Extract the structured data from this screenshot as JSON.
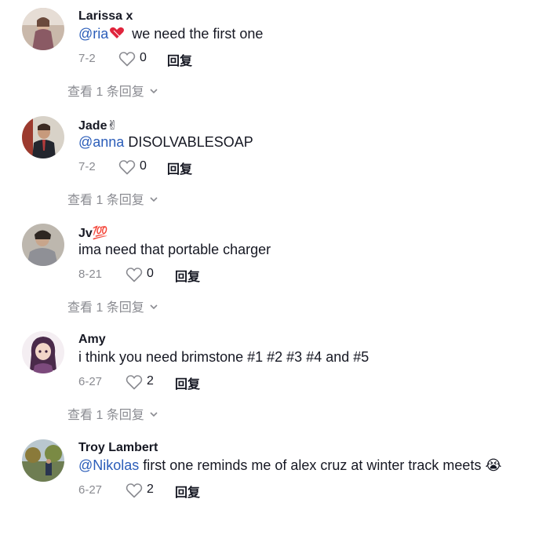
{
  "comments": [
    {
      "username": "Larissa x",
      "mention": "@ria",
      "text": " we need the first one",
      "date": "7-2",
      "likes": "0",
      "reply_label": "回复",
      "view_replies": "查看 1 条回复",
      "avatar_icon": "avatar-photo"
    },
    {
      "username": "Jade✌",
      "mention": "@anna",
      "text": " DISOLVABLESOAP",
      "date": "7-2",
      "likes": "0",
      "reply_label": "回复",
      "view_replies": "查看 1 条回复",
      "avatar_icon": "avatar-photo"
    },
    {
      "username": "Jv💯",
      "mention": "",
      "text": "ima need that portable charger",
      "date": "8-21",
      "likes": "0",
      "reply_label": "回复",
      "view_replies": "查看 1 条回复",
      "avatar_icon": "avatar-photo"
    },
    {
      "username": "Amy",
      "mention": "",
      "text": "i think you need brimstone #1 #2 #3 #4 and #5",
      "date": "6-27",
      "likes": "2",
      "reply_label": "回复",
      "view_replies": "查看 1 条回复",
      "avatar_icon": "avatar-illustration"
    },
    {
      "username": "Troy Lambert",
      "mention": "@Nikolas",
      "text": " first one reminds me of alex cruz at winter track meets 😭",
      "date": "6-27",
      "likes": "2",
      "reply_label": "回复",
      "view_replies": "",
      "avatar_icon": "avatar-photo"
    }
  ],
  "colors": {
    "mention": "#2b5db9",
    "muted": "#8a8b91",
    "text": "#161823"
  }
}
